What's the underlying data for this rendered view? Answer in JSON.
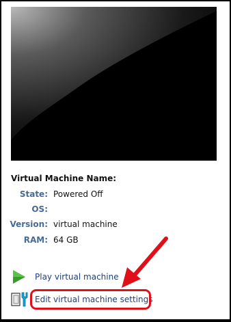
{
  "vm": {
    "title": "Virtual Machine Name:",
    "details": [
      {
        "label": "State:",
        "value": "Powered Off"
      },
      {
        "label": "OS:",
        "value": ""
      },
      {
        "label": "Version:",
        "value": "virtual machine"
      },
      {
        "label": "RAM:",
        "value": "64 GB"
      }
    ]
  },
  "actions": {
    "play": {
      "label": "Play virtual machine",
      "icon": "play-icon"
    },
    "edit": {
      "label": "Edit virtual machine settings",
      "icon": "settings-icon"
    }
  },
  "colors": {
    "annotation": "#e0101a",
    "label": "#4a6a93",
    "link": "#1f3f7a",
    "play_icon": "#3a9a2a",
    "settings_icon": "#1aa4d6"
  }
}
